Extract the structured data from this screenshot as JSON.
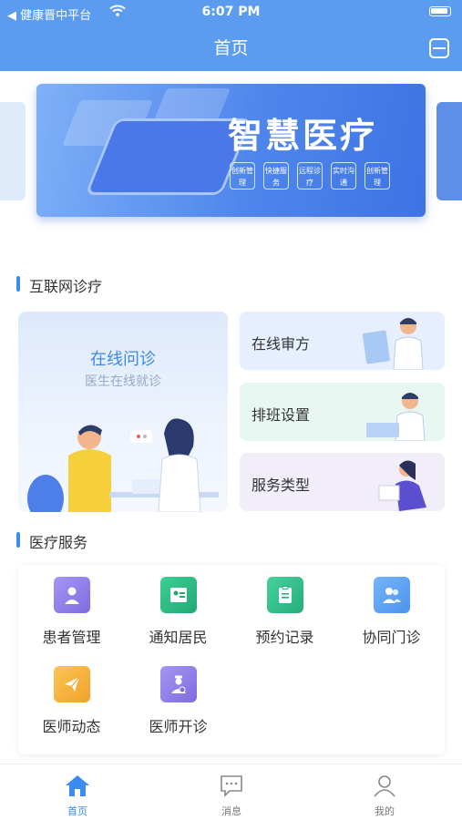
{
  "status_bar": {
    "carrier": "◀ 健康晋中平台",
    "time": "6:07 PM"
  },
  "header": {
    "title": "首页"
  },
  "banner": {
    "heading": "智慧医疗",
    "tags": [
      "创新管理",
      "快捷服务",
      "远程诊疗",
      "实时沟通",
      "创新管理"
    ]
  },
  "internet": {
    "section_title": "互联网诊疗",
    "main_card": {
      "title": "在线问诊",
      "subtitle": "医生在线就诊"
    },
    "cards": [
      "在线审方",
      "排班设置",
      "服务类型"
    ]
  },
  "services": {
    "section_title": "医疗服务",
    "items": [
      {
        "label": "患者管理",
        "icon": "patient-icon",
        "color": "#8e7ee8"
      },
      {
        "label": "通知居民",
        "icon": "notice-icon",
        "color": "#2fbf86"
      },
      {
        "label": "预约记录",
        "icon": "clipboard-icon",
        "color": "#33c08f"
      },
      {
        "label": "协同门诊",
        "icon": "group-icon",
        "color": "#5aa3f3"
      },
      {
        "label": "医师动态",
        "icon": "paper-plane-icon",
        "color": "#f7b43e"
      },
      {
        "label": "医师开诊",
        "icon": "doctor-icon",
        "color": "#8e7ee8"
      }
    ]
  },
  "tabbar": {
    "items": [
      "首页",
      "消息",
      "我的"
    ],
    "active": "首页"
  },
  "colors": {
    "primary": "#5b9cf0",
    "accent": "#3b8bf0"
  }
}
